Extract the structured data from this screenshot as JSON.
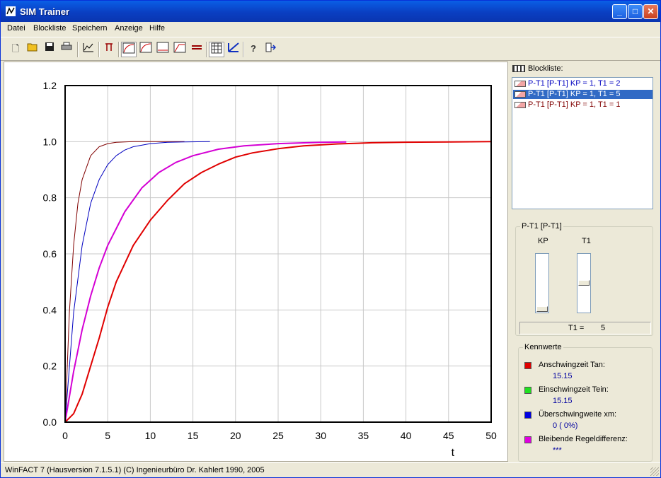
{
  "window": {
    "title": "SIM Trainer",
    "min": "_",
    "max": "□",
    "close": "✕"
  },
  "menu": [
    "Datei",
    "Blockliste",
    "Speichern",
    "Anzeige",
    "Hilfe"
  ],
  "toolbar_icons": [
    "new-icon",
    "open-icon",
    "save-icon",
    "print-icon",
    "block-edit-icon",
    "cursor-icon",
    "plot-one-icon",
    "plot-two-icon",
    "plot-three-icon",
    "plot-four-icon",
    "line-style-icon",
    "grid-icon",
    "autoscale-icon",
    "help-icon",
    "exit-icon"
  ],
  "blockliste": {
    "header": "Blockliste:",
    "items": [
      {
        "label": "P-T1 [P-T1] KP = 1, T1 = 2",
        "color": "#0000C0",
        "selected": false
      },
      {
        "label": "P-T1 [P-T1] KP = 1, T1 = 5",
        "color": "#D400D4",
        "selected": true
      },
      {
        "label": "P-T1 [P-T1] KP = 1, T1 = 1",
        "color": "#800000",
        "selected": false
      }
    ]
  },
  "params": {
    "group_title": "P-T1 [P-T1]",
    "kp_label": "KP",
    "t1_label": "T1",
    "kp_level": 0.0,
    "t1_level": 0.5,
    "value_name": "T1 =",
    "value": "5"
  },
  "kennwerte": {
    "title": "Kennwerte",
    "items": [
      {
        "label": "Anschwingzeit Tan:",
        "value": "15.15",
        "color": "#E00000"
      },
      {
        "label": "Einschwingzeit Tein:",
        "value": "15.15",
        "color": "#20E020"
      },
      {
        "label": "Überschwingweite xm:",
        "value": "0 (   0%)",
        "color": "#0000E0"
      },
      {
        "label": "Bleibende Regeldifferenz:",
        "value": "***",
        "color": "#E000E0"
      }
    ]
  },
  "status": "WinFACT 7 (Hausversion 7.1.5.1)  (C) Ingenieurbüro Dr. Kahlert 1990, 2005",
  "chart_data": {
    "type": "line",
    "xlabel": "t",
    "ylabel": "",
    "xlim": [
      0,
      50
    ],
    "ylim": [
      0,
      1.2
    ],
    "xticks": [
      0,
      5,
      10,
      15,
      20,
      25,
      30,
      35,
      40,
      45,
      50
    ],
    "yticks": [
      0.0,
      0.2,
      0.4,
      0.6,
      0.8,
      1.0,
      1.2
    ],
    "grid": true,
    "series": [
      {
        "color": "#800000",
        "x": [
          0,
          0.5,
          1,
          1.5,
          2,
          3,
          4,
          5,
          6,
          7,
          8,
          10,
          14
        ],
        "y": [
          0,
          0.39,
          0.63,
          0.78,
          0.865,
          0.95,
          0.982,
          0.993,
          0.9975,
          0.999,
          1.0,
          1.0,
          1.0
        ]
      },
      {
        "color": "#0000C0",
        "x": [
          0,
          1,
          2,
          3,
          4,
          5,
          6,
          7,
          8,
          10,
          12,
          14,
          17
        ],
        "y": [
          0,
          0.39,
          0.63,
          0.78,
          0.865,
          0.918,
          0.95,
          0.97,
          0.982,
          0.993,
          0.9975,
          0.999,
          1.0
        ]
      },
      {
        "color": "#D400D4",
        "x": [
          0,
          1,
          2,
          3,
          4,
          5,
          7,
          9,
          11,
          13,
          15,
          18,
          21,
          25,
          30,
          33
        ],
        "y": [
          0,
          0.18,
          0.33,
          0.45,
          0.55,
          0.63,
          0.75,
          0.835,
          0.89,
          0.926,
          0.95,
          0.973,
          0.985,
          0.993,
          0.9975,
          0.999
        ]
      },
      {
        "color": "#E00000",
        "x": [
          0,
          1,
          2,
          3,
          4,
          5,
          6,
          8,
          10,
          12,
          14,
          16,
          18,
          20,
          22,
          25,
          28,
          32,
          36,
          40,
          45,
          50
        ],
        "y": [
          0,
          0.03,
          0.1,
          0.2,
          0.3,
          0.41,
          0.5,
          0.63,
          0.72,
          0.79,
          0.85,
          0.89,
          0.92,
          0.945,
          0.96,
          0.975,
          0.985,
          0.992,
          0.996,
          0.998,
          0.999,
          1.0
        ]
      }
    ]
  }
}
